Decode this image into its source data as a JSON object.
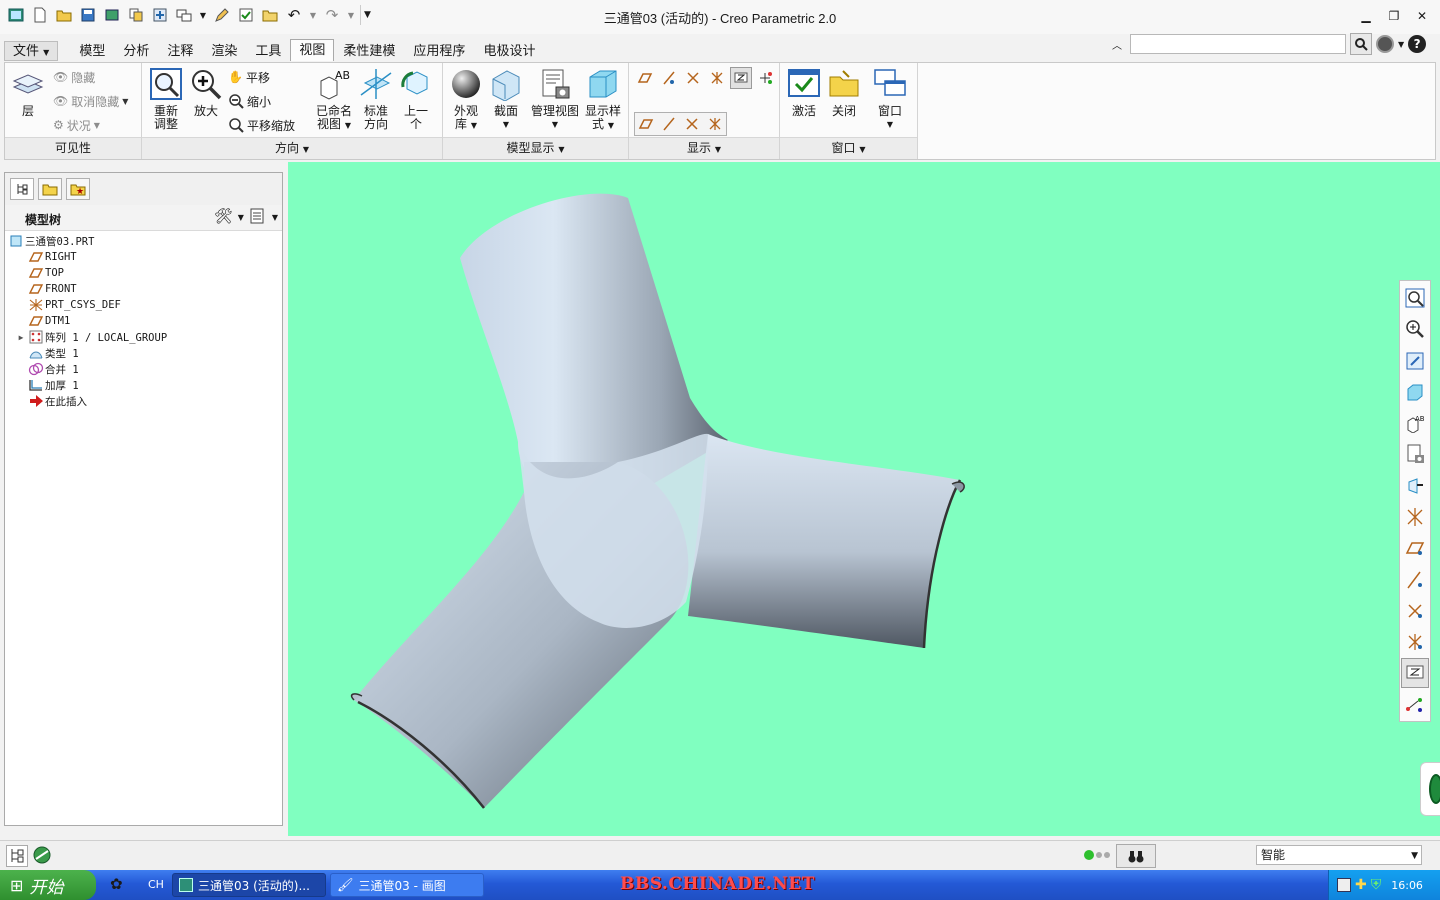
{
  "window": {
    "title": "三通管03 (活动的) - Creo Parametric 2.0"
  },
  "menu": {
    "file": "文件",
    "tabs": [
      "模型",
      "分析",
      "注释",
      "渲染",
      "工具",
      "视图",
      "柔性建模",
      "应用程序",
      "电极设计"
    ],
    "active_tab": "视图"
  },
  "search": {
    "value": ""
  },
  "ribbon": {
    "visibility": {
      "label": "可见性",
      "layer": "层",
      "hide": "隐藏",
      "unhide": "取消隐藏",
      "status": "状况"
    },
    "orientation": {
      "label": "方向",
      "refit_1": "重新",
      "refit_2": "调整",
      "zoom_in": "放大",
      "pan": "平移",
      "zoom_out": "缩小",
      "pan_zoom": "平移缩放",
      "named_view_1": "已命名",
      "named_view_2": "视图",
      "standard_1": "标准",
      "standard_2": "方向",
      "previous_1": "上一",
      "previous_2": "个"
    },
    "model_display": {
      "label": "模型显示",
      "appearance_1": "外观",
      "appearance_2": "库",
      "section": "截面",
      "manage_views": "管理视图",
      "display_style_1": "显示样",
      "display_style_2": "式"
    },
    "show": {
      "label": "显示"
    },
    "window": {
      "label": "窗口",
      "activate": "激活",
      "close": "关闭",
      "windows": "窗口"
    }
  },
  "model_tree": {
    "title": "模型树",
    "items": [
      {
        "label": "三通管03.PRT",
        "icon": "part-icon"
      },
      {
        "label": "RIGHT",
        "icon": "datum-plane-icon"
      },
      {
        "label": "TOP",
        "icon": "datum-plane-icon"
      },
      {
        "label": "FRONT",
        "icon": "datum-plane-icon"
      },
      {
        "label": "PRT_CSYS_DEF",
        "icon": "csys-icon"
      },
      {
        "label": "DTM1",
        "icon": "datum-plane-icon"
      },
      {
        "label": "阵列 1 / LOCAL_GROUP",
        "icon": "pattern-icon"
      },
      {
        "label": "类型 1",
        "icon": "style-icon"
      },
      {
        "label": "合并 1",
        "icon": "merge-icon"
      },
      {
        "label": "加厚 1",
        "icon": "thicken-icon"
      },
      {
        "label": "在此插入",
        "icon": "insert-here-icon"
      }
    ]
  },
  "status": {
    "selection_filter": "智能"
  },
  "taskbar": {
    "start": "开始",
    "lang": "CH",
    "tasks": [
      "三通管03 (活动的)...",
      "三通管03 - 画图"
    ],
    "watermark": "BBS.CHINADE.NET",
    "clock": "16:06"
  },
  "colors": {
    "viewport_bg": "#80ffc0",
    "model_shade": "#c9d9ea"
  }
}
